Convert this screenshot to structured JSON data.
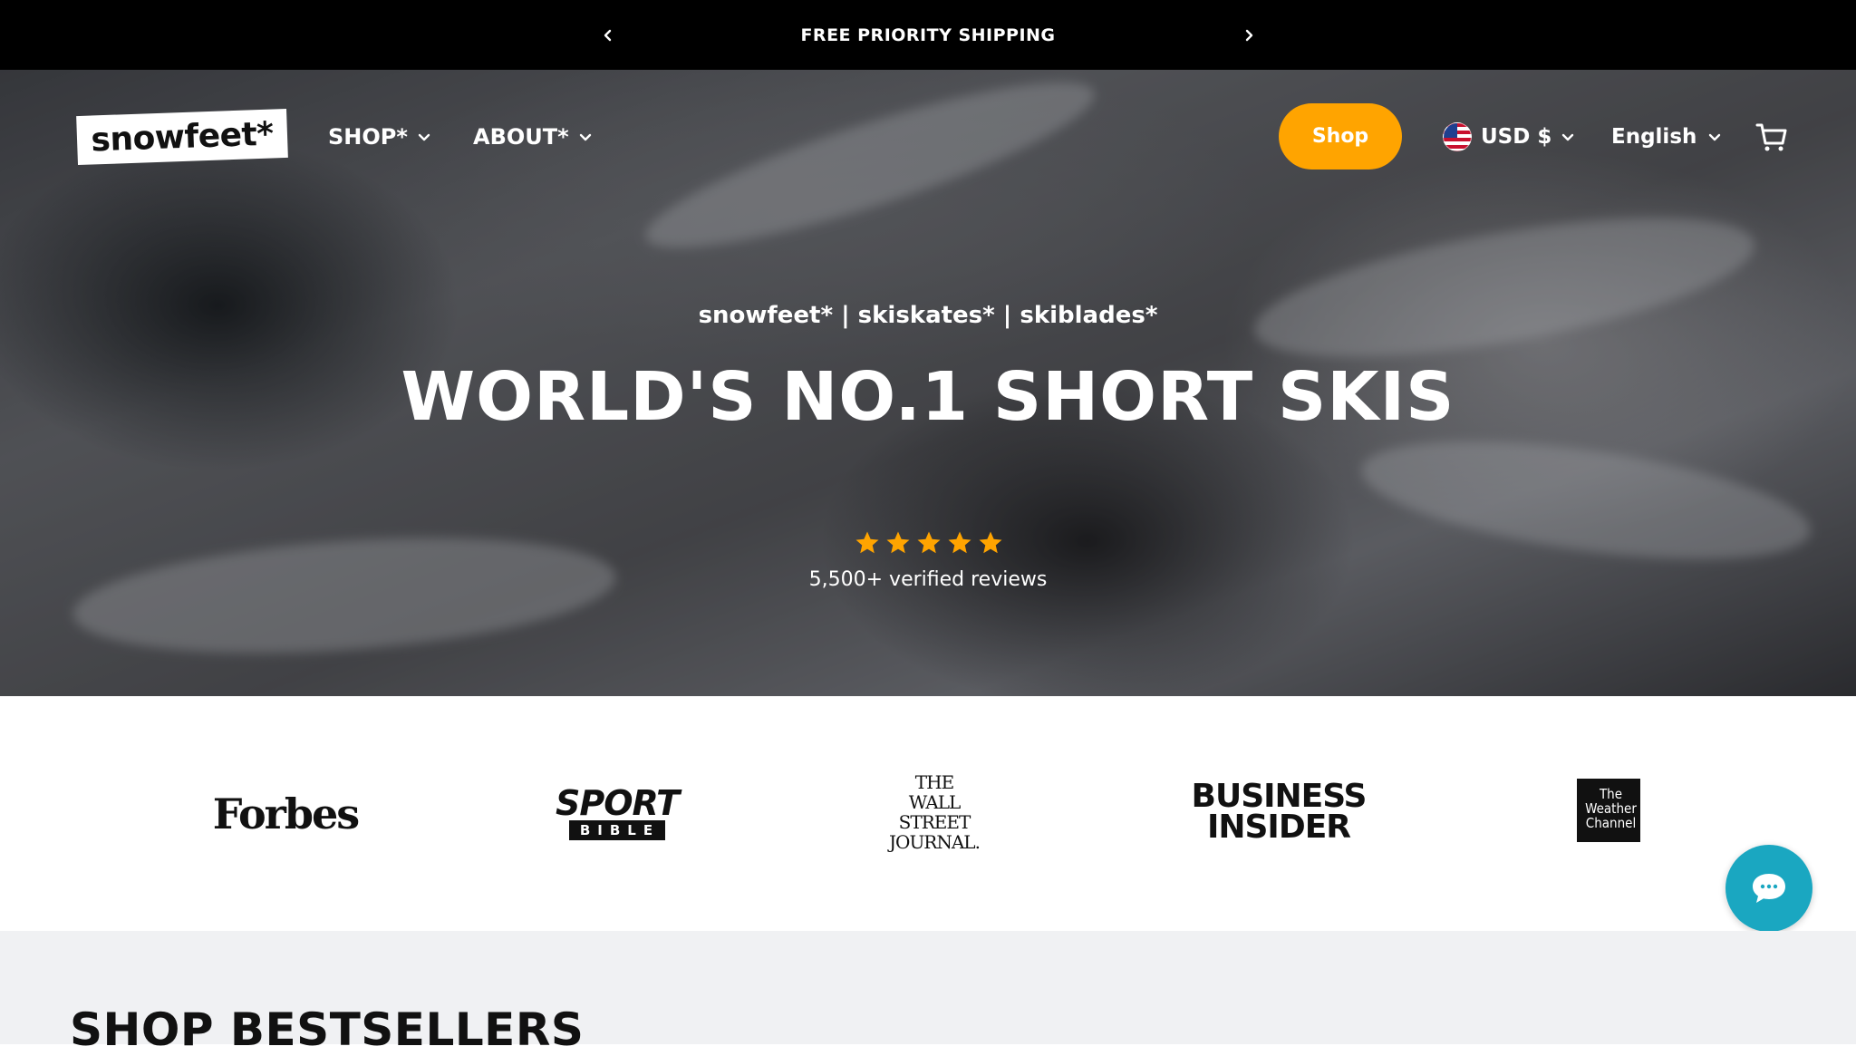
{
  "announcement": {
    "text": "FREE PRIORITY SHIPPING",
    "prev_icon": "chevron-left-icon",
    "next_icon": "chevron-right-icon"
  },
  "header": {
    "logo_text": "snowfeet*",
    "nav": [
      {
        "label": "SHOP*"
      },
      {
        "label": "ABOUT*"
      }
    ],
    "shop_button": "Shop",
    "currency": "USD $",
    "language": "English",
    "cart_icon": "cart-icon"
  },
  "hero": {
    "subtitle": "snowfeet* | skiskates* | skiblades*",
    "title": "WORLD'S NO.1 SHORT SKIS",
    "rating_stars": 5,
    "reviews_text": "5,500+ verified reviews"
  },
  "press": {
    "logos": [
      {
        "name": "Forbes",
        "text": "Forbes"
      },
      {
        "name": "SportBible",
        "text": "SPORT",
        "subtext": "BIBLE"
      },
      {
        "name": "The Wall Street Journal",
        "lines": [
          "THE",
          "WALL STREET",
          "JOURNAL."
        ]
      },
      {
        "name": "Business Insider",
        "lines": [
          "BUSINESS",
          "INSIDER"
        ]
      },
      {
        "name": "The Weather Channel",
        "lines": [
          "The",
          "Weather",
          "Channel"
        ]
      }
    ]
  },
  "chat": {
    "icon": "chat-bubble-icon"
  },
  "bestsellers": {
    "heading": "SHOP BESTSELLERS"
  },
  "colors": {
    "accent": "#ffa400",
    "chat": "#1aa7c1",
    "announcement_bg": "#000000",
    "star": "#ffa400",
    "section_bg": "#f0f1f3"
  }
}
